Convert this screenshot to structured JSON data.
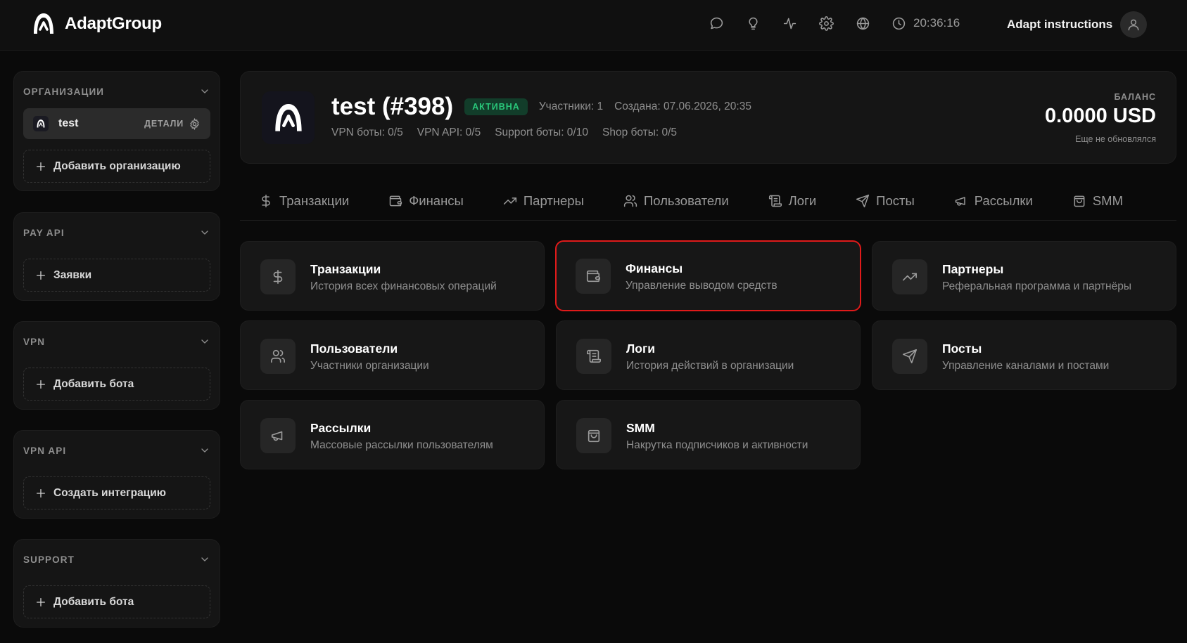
{
  "app": {
    "brand": "AdaptGroup",
    "time": "20:36:16",
    "instructions_label": "Adapt instructions",
    "top_icons": [
      "chat-icon",
      "lightbulb-icon",
      "activity-icon",
      "gear-icon",
      "globe-icon"
    ]
  },
  "sidebar": {
    "orgs": {
      "title": "ОРГАНИЗАЦИИ",
      "item_name": "test",
      "item_details": "ДЕТАЛИ",
      "add_label": "Добавить организацию"
    },
    "pay_api": {
      "title": "PAY API",
      "button": "Заявки"
    },
    "vpn": {
      "title": "VPN",
      "button": "Добавить бота"
    },
    "vpn_api": {
      "title": "VPN API",
      "button": "Создать интеграцию"
    },
    "support": {
      "title": "SUPPORT",
      "button": "Добавить бота"
    }
  },
  "header": {
    "title": "test (#398)",
    "status": "АКТИВНА",
    "members": "Участники: 1",
    "created": "Создана: 07.06.2026, 20:35",
    "stats": [
      "VPN боты: 0/5",
      "VPN API: 0/5",
      "Support боты: 0/10",
      "Shop боты: 0/5"
    ],
    "balance_label": "БАЛАНС",
    "balance": "0.0000 USD",
    "balance_note": "Еще не обновлялся"
  },
  "tabs": [
    {
      "label": "Транзакции",
      "icon": "dollar-icon"
    },
    {
      "label": "Финансы",
      "icon": "wallet-icon"
    },
    {
      "label": "Партнеры",
      "icon": "trending-icon"
    },
    {
      "label": "Пользователи",
      "icon": "users-icon"
    },
    {
      "label": "Логи",
      "icon": "scroll-icon"
    },
    {
      "label": "Посты",
      "icon": "send-icon"
    },
    {
      "label": "Рассылки",
      "icon": "megaphone-icon"
    },
    {
      "label": "SMM",
      "icon": "bag-icon"
    }
  ],
  "cards": [
    {
      "title": "Транзакции",
      "desc": "История всех финансовых операций",
      "icon": "dollar-icon"
    },
    {
      "title": "Финансы",
      "desc": "Управление выводом средств",
      "icon": "wallet-icon",
      "highlighted": true
    },
    {
      "title": "Партнеры",
      "desc": "Реферальная программа и партнёры",
      "icon": "trending-icon"
    },
    {
      "title": "Пользователи",
      "desc": "Участники организации",
      "icon": "users-icon"
    },
    {
      "title": "Логи",
      "desc": "История действий в организации",
      "icon": "scroll-icon"
    },
    {
      "title": "Посты",
      "desc": "Управление каналами и постами",
      "icon": "send-icon"
    },
    {
      "title": "Рассылки",
      "desc": "Массовые рассылки пользователям",
      "icon": "megaphone-icon"
    },
    {
      "title": "SMM",
      "desc": "Накрутка подписчиков и активности",
      "icon": "bag-icon"
    }
  ],
  "colors": {
    "background": "#0a0a0a",
    "panel": "#151515",
    "active_badge": "#29c77a",
    "highlight_border": "#e01a1a"
  }
}
